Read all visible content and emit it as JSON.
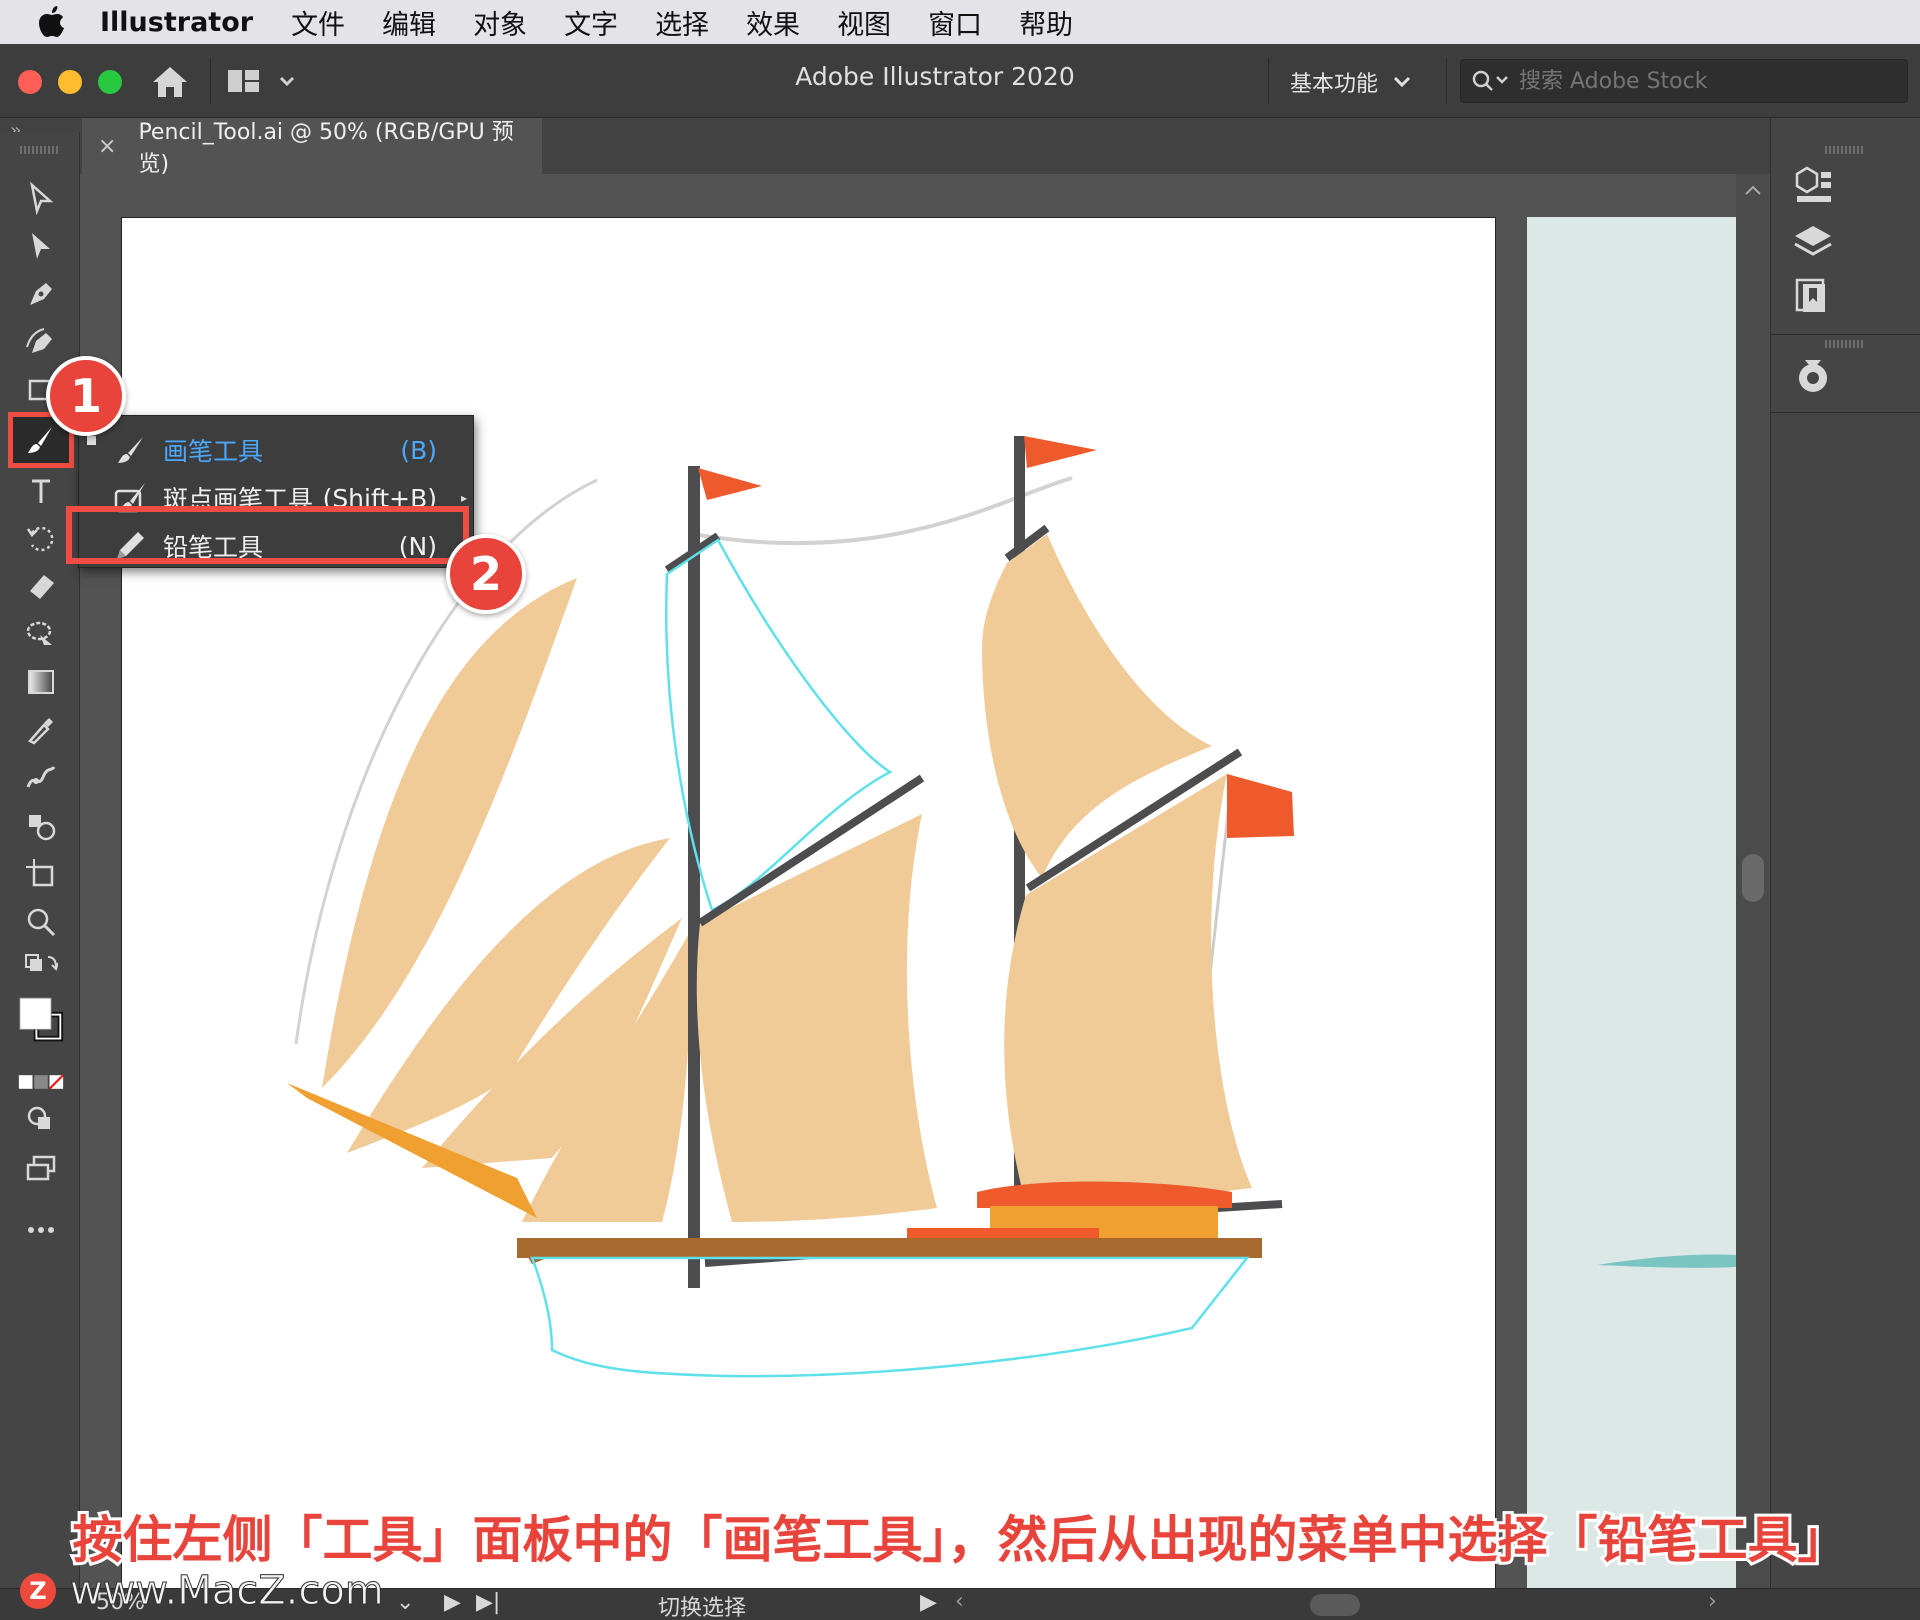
{
  "menubar": {
    "app_name": "Illustrator",
    "items": [
      "文件",
      "编辑",
      "对象",
      "文字",
      "选择",
      "效果",
      "视图",
      "窗口",
      "帮助"
    ]
  },
  "titlebar": {
    "title": "Adobe Illustrator 2020",
    "workspace": "基本功能",
    "search_placeholder": "搜索 Adobe Stock"
  },
  "document_tab": {
    "close": "×",
    "title": "Pencil_Tool.ai @ 50% (RGB/GPU 预览)"
  },
  "flyout_menu": {
    "items": [
      {
        "label": "画笔工具",
        "shortcut": "(B)",
        "icon": "paintbrush-icon",
        "active": true
      },
      {
        "label": "斑点画笔工具",
        "shortcut": "(Shift+B)",
        "icon": "blob-brush-icon",
        "active": false
      },
      {
        "label": "铅笔工具",
        "shortcut": "(N)",
        "icon": "pencil-icon",
        "active": false
      }
    ]
  },
  "badges": [
    "1",
    "2"
  ],
  "caption": "按住左侧「工具」面板中的「画笔工具」，然后从出现的菜单中选择「铅笔工具」",
  "statusbar": {
    "zoom": "50%",
    "toggle_label": "切换选择"
  },
  "watermark": {
    "logo": "Z",
    "text": "www.MacZ.com"
  },
  "colors": {
    "accent_red": "#e8443b",
    "sail": "#f0cb98",
    "flag": "#ee5a2c",
    "hull_deck": "#a86a2e",
    "mast": "#4d4d4f",
    "selection": "#5fe0ea",
    "sea": "#dbe8e6",
    "active_menu": "#4aa8ff"
  }
}
